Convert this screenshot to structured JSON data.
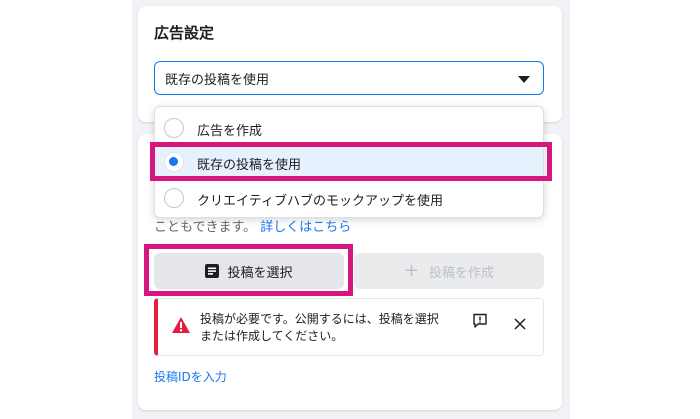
{
  "ad_settings": {
    "title": "広告設定",
    "select_value": "既存の投稿を使用",
    "options": [
      {
        "label": "広告を作成",
        "selected": false
      },
      {
        "label": "既存の投稿を使用",
        "selected": true
      },
      {
        "label": "クリエイティブハブのモックアップを使用",
        "selected": false
      }
    ]
  },
  "post": {
    "description": "こともできます。",
    "learn_more": "詳しくはこちら",
    "select_button": "投稿を選択",
    "create_button": "投稿を作成",
    "error_line1": "投稿が必要です。公開するには、投稿を選択",
    "error_line2": "または作成してください。",
    "enter_id_link": "投稿IDを入力"
  },
  "colors": {
    "accent": "#1877f2",
    "highlight": "#d6177f",
    "error": "#e41e3f"
  }
}
